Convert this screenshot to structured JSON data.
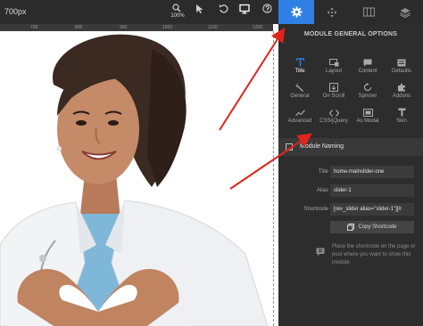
{
  "toolbar": {
    "width_label": "700px",
    "zoom_value": "100%"
  },
  "ruler": {
    "ticks": [
      "700",
      "800",
      "900",
      "1000",
      "1100",
      "1200"
    ]
  },
  "panel": {
    "title": "MODULE GENERAL OPTIONS",
    "grid_items": [
      {
        "label": "Title",
        "icon": "title-icon"
      },
      {
        "label": "Layout",
        "icon": "layout-icon"
      },
      {
        "label": "Content",
        "icon": "content-icon"
      },
      {
        "label": "Defaults",
        "icon": "defaults-icon"
      },
      {
        "label": "General",
        "icon": "wrench-icon"
      },
      {
        "label": "On Scroll",
        "icon": "scroll-icon"
      },
      {
        "label": "Spinner",
        "icon": "spinner-icon"
      },
      {
        "label": "Addons",
        "icon": "puzzle-icon"
      },
      {
        "label": "Advanced",
        "icon": "chart-icon"
      },
      {
        "label": "CSS/jQuery",
        "icon": "code-icon"
      },
      {
        "label": "As Modal",
        "icon": "modal-icon"
      },
      {
        "label": "Skin",
        "icon": "skin-icon"
      }
    ],
    "section_title": "Module Naming",
    "fields": {
      "title_label": "Title",
      "title_value": "home-mainslider-one",
      "alias_label": "Alias",
      "alias_value": "slider-1",
      "shortcode_label": "Shortcode",
      "shortcode_value": "[rev_slider alias=\"slider-1\"][/r"
    },
    "copy_button": "Copy Shortcode",
    "info_text": "Place the shortcode on the page or post where you want to show this module."
  },
  "colors": {
    "accent": "#2f7fe5",
    "arrow": "#e0241b",
    "panel_bg": "#2d2d2d",
    "toolbar_bg": "#2b2b2b"
  }
}
